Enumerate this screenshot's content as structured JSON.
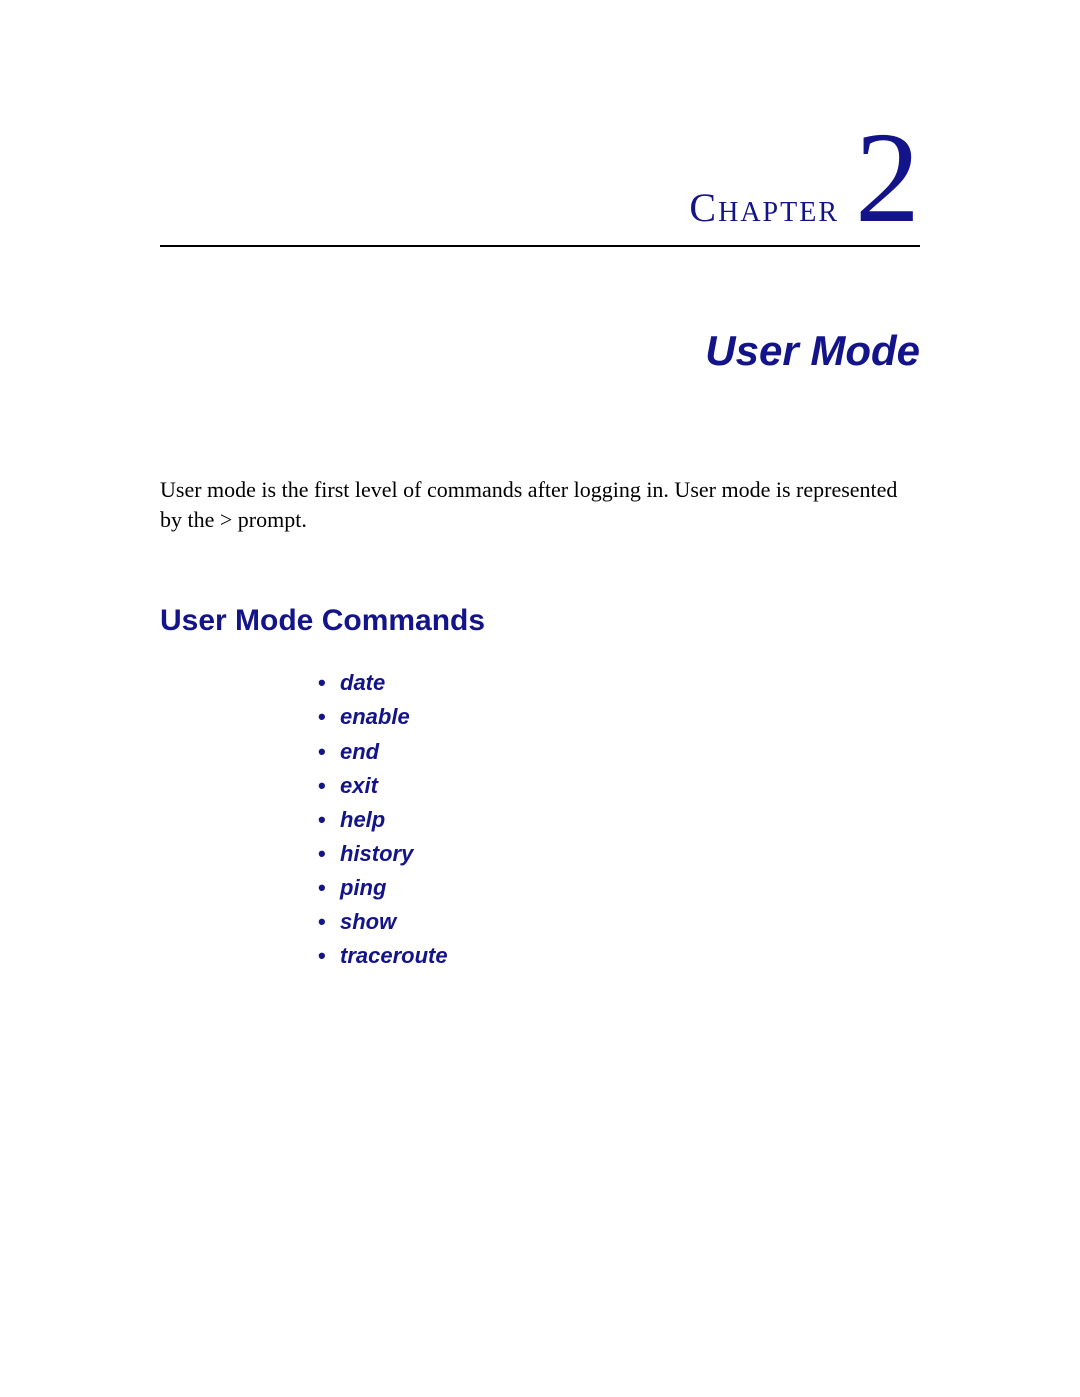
{
  "chapter": {
    "label": "Chapter",
    "number": "2",
    "title": "User Mode"
  },
  "intro": "User mode is the first level of commands after logging in. User mode is represented by the > prompt.",
  "section": {
    "heading": "User Mode Commands",
    "commands": [
      "date",
      "enable",
      "end",
      "exit",
      "help",
      "history",
      "ping",
      "show",
      "traceroute"
    ]
  }
}
